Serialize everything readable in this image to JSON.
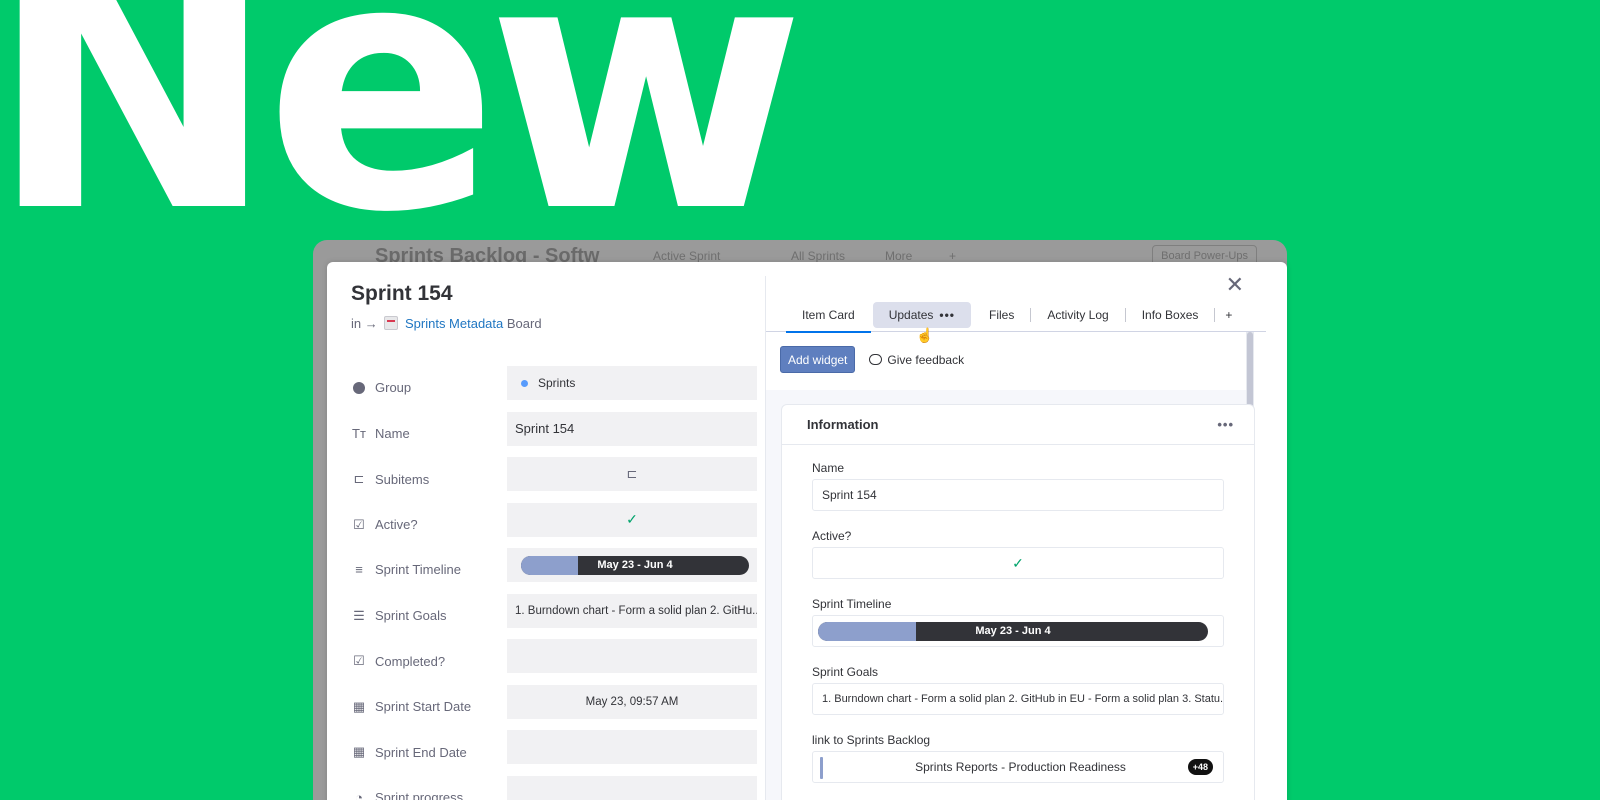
{
  "hero": {
    "word": "New"
  },
  "background_board": {
    "title": "Sprints Backlog - Softw",
    "views": [
      "Active Sprint",
      "All Sprints",
      "More",
      "+"
    ],
    "power_ups": "Board Power-Ups"
  },
  "item": {
    "title": "Sprint 154",
    "board_prefix": "in →",
    "board_link": "Sprints Metadata",
    "board_suffix": "Board"
  },
  "fields": [
    {
      "label": "Group",
      "icon": "group-icon",
      "value": "Sprints",
      "accent": "#579bfc"
    },
    {
      "label": "Name",
      "icon": "text-icon",
      "value": "Sprint 154"
    },
    {
      "label": "Subitems",
      "icon": "subitems-icon",
      "value": ""
    },
    {
      "label": "Active?",
      "icon": "checkbox-icon",
      "value": "✓"
    },
    {
      "label": "Sprint Timeline",
      "icon": "timeline-icon",
      "value": "May 23 - Jun 4",
      "fill": 0.25
    },
    {
      "label": "Sprint Goals",
      "icon": "long-text-icon",
      "value": "1. Burndown chart - Form a solid plan 2. GitHu..."
    },
    {
      "label": "Completed?",
      "icon": "checkbox-icon",
      "value": ""
    },
    {
      "label": "Sprint Start Date",
      "icon": "calendar-icon",
      "value": "May 23, 09:57 AM"
    },
    {
      "label": "Sprint End Date",
      "icon": "calendar-icon",
      "value": ""
    },
    {
      "label": "Sprint progress",
      "icon": "progress-icon",
      "value": ""
    }
  ],
  "progress_colors": [
    "#8fb89a",
    "#d9b899",
    "#7a9a86",
    "#8a6e64",
    "#b0575e",
    "#5a6ea0",
    "#30305a"
  ],
  "tabs": {
    "item_card": "Item Card",
    "updates": "Updates",
    "updates_more": "•••",
    "files": "Files",
    "activity_log": "Activity Log",
    "info_boxes": "Info Boxes",
    "add": "+"
  },
  "toolbar": {
    "add_widget": "Add widget",
    "give_feedback": "Give feedback"
  },
  "info_card": {
    "title": "Information",
    "menu": "•••",
    "name_label": "Name",
    "name_value": "Sprint 154",
    "active_label": "Active?",
    "active_value": "✓",
    "timeline_label": "Sprint Timeline",
    "timeline_value": "May 23 - Jun 4",
    "timeline_fill": 0.25,
    "goals_label": "Sprint Goals",
    "goals_value": "1. Burndown chart - Form a solid plan 2. GitHub in EU - Form a solid plan 3. Statu...",
    "link_label": "link to Sprints Backlog",
    "link_value": "Sprints Reports - Production Readiness",
    "link_more": "+48"
  },
  "colors": {
    "brand_green": "#00ca6b",
    "accent_blue": "#0073ea",
    "timeline_fill": "#8d9fcc",
    "timeline_dark": "#323338"
  }
}
